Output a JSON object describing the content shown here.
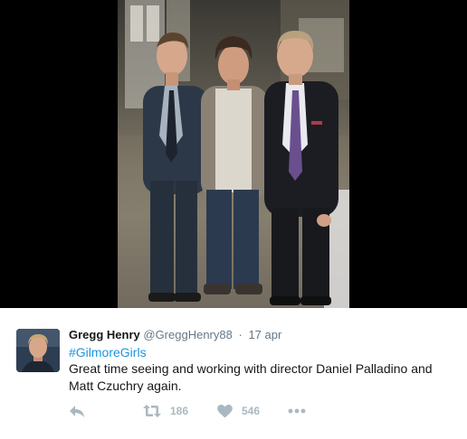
{
  "tweet": {
    "author_name": "Gregg Henry",
    "author_handle": "@GreggHenry88",
    "separator": "·",
    "date": "17 apr",
    "hashtag": "#GilmoreGirls",
    "text": "Great time seeing and working with director Daniel Palladino and Matt Czuchry again.",
    "retweet_count": "186",
    "like_count": "546"
  },
  "icons": {
    "reply": "reply-icon",
    "retweet": "retweet-icon",
    "like": "heart-icon",
    "more": "more-dots-icon"
  },
  "colors": {
    "link": "#1b95e0",
    "muted": "#657786",
    "action": "#aab8c2",
    "media_background": "#000000"
  }
}
